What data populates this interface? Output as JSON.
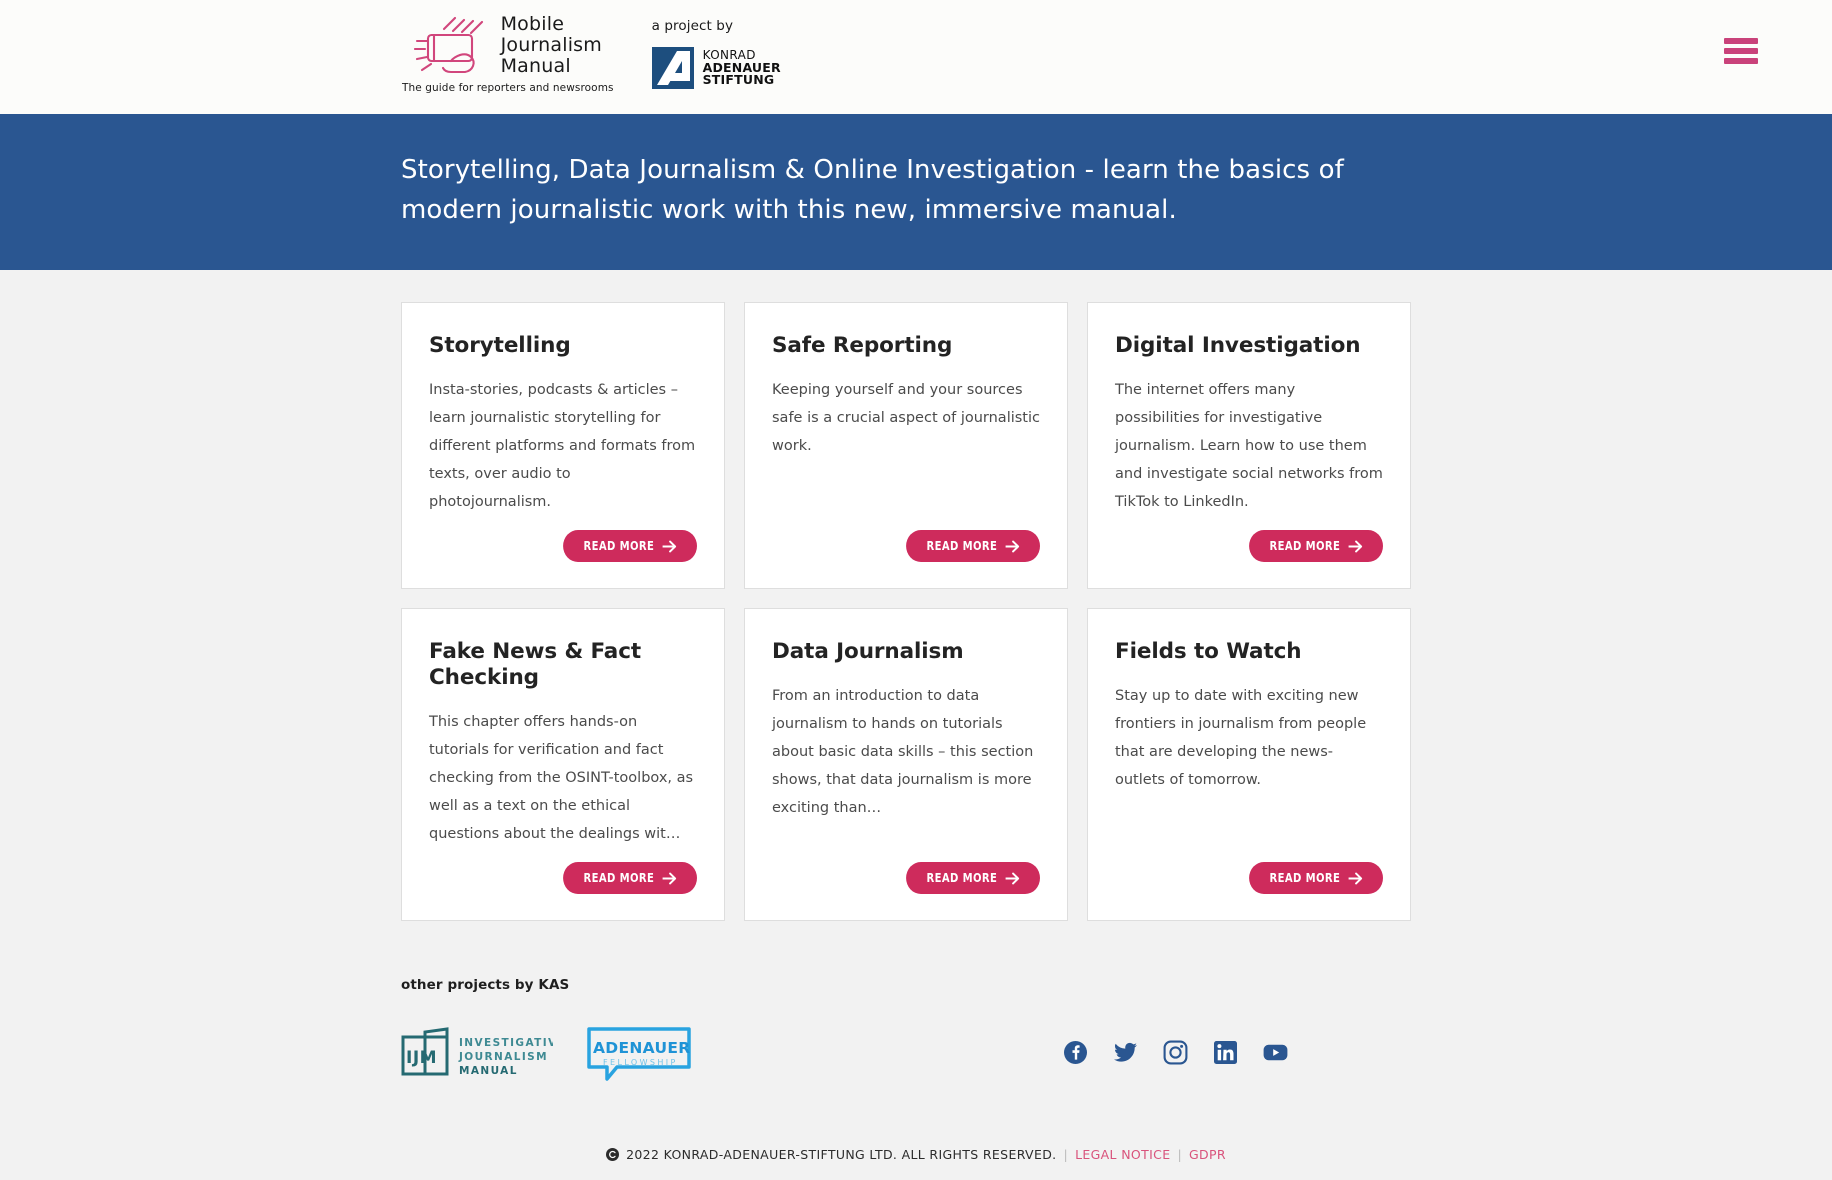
{
  "header": {
    "brand": {
      "logo_icon": "hand-holding-phone-icon",
      "line1": "Mobile",
      "line2": "Journalism",
      "line3": "Manual",
      "tagline": "The guide for reporters and newsrooms"
    },
    "project_by": {
      "label": "a project by",
      "logo_icon": "kas-logo-icon",
      "name_line1": "KONRAD",
      "name_line2": "ADENAUER",
      "name_line3": "STIFTUNG"
    },
    "menu_icon": "hamburger-menu-icon"
  },
  "banner": {
    "text": "Storytelling, Data Journalism & Online Investigation - learn the basics of modern journalistic work with this new, immersive manual."
  },
  "cards": [
    {
      "title": "Storytelling",
      "description": "Insta-stories, podcasts & articles – learn journalistic storytelling for different platforms and formats from texts, over audio to photojournalism.",
      "cta": "READ MORE"
    },
    {
      "title": "Safe Reporting",
      "description": "Keeping yourself and your sources safe is a crucial aspect of journalistic work.",
      "cta": "READ MORE"
    },
    {
      "title": "Digital Investigation",
      "description": "The internet offers many possibilities for investigative journalism. Learn how to use them and investigate social networks from TikTok to LinkedIn.",
      "cta": "READ MORE"
    },
    {
      "title": "Fake News & Fact Checking",
      "description": "This chapter offers hands-on tutorials for verification and fact checking from the OSINT-toolbox, as well as a text on the ethical questions about the dealings wit…",
      "cta": "READ MORE"
    },
    {
      "title": "Data Journalism",
      "description": "From an introduction to data journalism to hands on tutorials about basic data skills – this section shows, that data journalism is more exciting than…",
      "cta": "READ MORE"
    },
    {
      "title": "Fields to Watch",
      "description": "Stay up to date with exciting new frontiers in journalism from people that are developing the news-outlets of tomorrow.",
      "cta": "READ MORE"
    }
  ],
  "footer": {
    "other_projects_label": "other projects by KAS",
    "partners": [
      {
        "icon": "ijm-logo-icon",
        "abbr": "IJM",
        "line1": "INVESTIGATIVE",
        "line2": "JOURNALISM",
        "line3": "MANUAL"
      },
      {
        "icon": "adenauer-fellowship-logo-icon",
        "line1": "ADENAUER",
        "line2": "FELLOWSHIP"
      }
    ],
    "social": [
      {
        "name": "facebook-icon",
        "label": "Facebook"
      },
      {
        "name": "twitter-icon",
        "label": "Twitter"
      },
      {
        "name": "instagram-icon",
        "label": "Instagram"
      },
      {
        "name": "linkedin-icon",
        "label": "LinkedIn"
      },
      {
        "name": "youtube-icon",
        "label": "YouTube"
      }
    ],
    "copyright": {
      "mark_icon": "copyright-icon",
      "text": "2022 KONRAD-ADENAUER-STIFTUNG LTD. ALL RIGHTS RESERVED.",
      "sep": "|",
      "legal_notice": "LEGAL NOTICE",
      "gdpr": "GDPR"
    }
  },
  "colors": {
    "banner_blue": "#2a5691",
    "accent_pink": "#ce2b5c",
    "brand_pink": "#c9427a",
    "kas_blue": "#1d4e7e",
    "ijm_teal": "#256a72",
    "adf_blue": "#29a3e0",
    "social_blue": "#2a5691",
    "page_bg": "#f2f2f2"
  }
}
